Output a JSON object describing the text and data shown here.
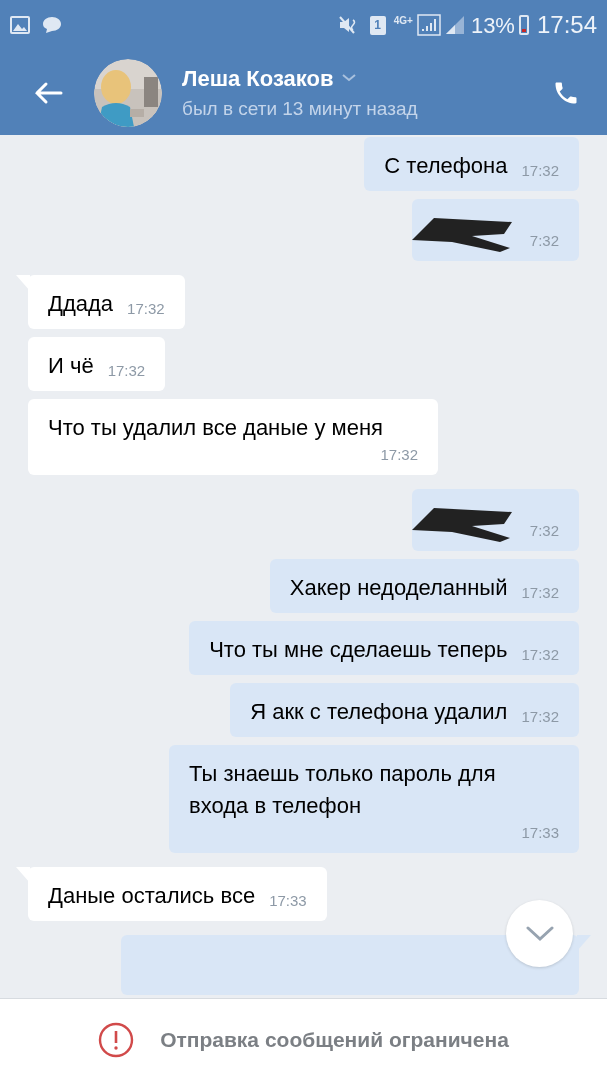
{
  "status_bar": {
    "sim": "1",
    "network": "4G+",
    "battery": "13%",
    "time": "17:54"
  },
  "header": {
    "name": "Леша Козаков",
    "status": "был в сети 13 минут назад"
  },
  "messages": [
    {
      "outgoing": true,
      "kind": "text",
      "text": "С телефона",
      "time": "17:32",
      "tail": false
    },
    {
      "outgoing": true,
      "kind": "redacted",
      "time": "7:32",
      "tail": false
    },
    {
      "outgoing": false,
      "kind": "text",
      "text": "Ддада",
      "time": "17:32",
      "tail": true
    },
    {
      "outgoing": false,
      "kind": "text",
      "text": "И чё",
      "time": "17:32",
      "tail": false
    },
    {
      "outgoing": false,
      "kind": "text",
      "text": "Что ты удалил все даные у меня",
      "time": "17:32",
      "tail": false
    },
    {
      "outgoing": true,
      "kind": "redacted",
      "time": "7:32",
      "tail": false
    },
    {
      "outgoing": true,
      "kind": "text",
      "text": "Хакер недоделанный",
      "time": "17:32",
      "tail": false
    },
    {
      "outgoing": true,
      "kind": "text",
      "text": "Что ты мне сделаешь теперь",
      "time": "17:32",
      "tail": false
    },
    {
      "outgoing": true,
      "kind": "text",
      "text": "Я акк с телефона удалил",
      "time": "17:32",
      "tail": false
    },
    {
      "outgoing": true,
      "kind": "text",
      "text": "Ты знаешь только пароль для входа в телефон",
      "time": "17:33",
      "tail": false
    },
    {
      "outgoing": false,
      "kind": "text",
      "text": "Даные остались все",
      "time": "17:33",
      "tail": true
    },
    {
      "outgoing": true,
      "kind": "cut",
      "tail": true
    }
  ],
  "footer": {
    "notice": "Отправка сообщений ограничена"
  }
}
